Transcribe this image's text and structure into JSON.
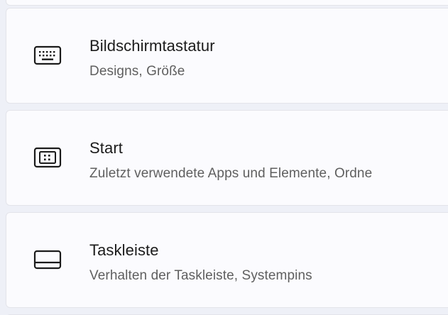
{
  "settings_items": [
    {
      "title": "Bildschirmtastatur",
      "subtitle": "Designs, Größe",
      "icon": "keyboard-icon"
    },
    {
      "title": "Start",
      "subtitle": "Zuletzt verwendete Apps und Elemente, Ordne",
      "icon": "start-menu-icon"
    },
    {
      "title": "Taskleiste",
      "subtitle": "Verhalten der Taskleiste, Systempins",
      "icon": "taskbar-icon"
    }
  ]
}
